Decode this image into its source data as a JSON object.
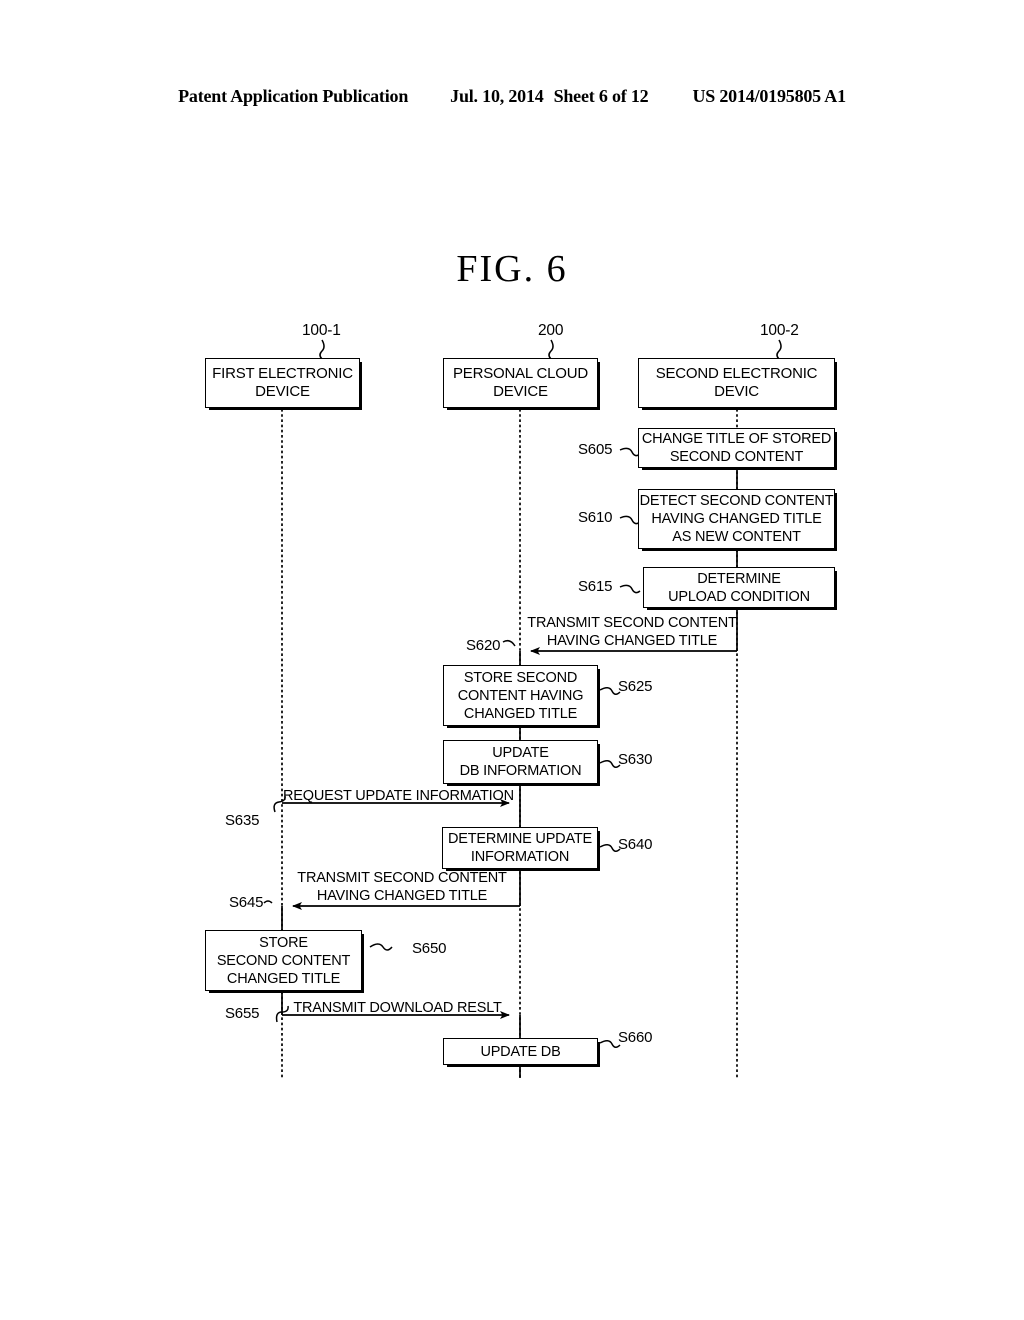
{
  "header": {
    "publication": "Patent Application Publication",
    "date": "Jul. 10, 2014",
    "sheet": "Sheet 6 of 12",
    "patent_number": "US 2014/0195805 A1"
  },
  "figure": {
    "caption": "FIG.  6"
  },
  "actors": [
    {
      "id": "first-electronic-device",
      "ref": "100-1",
      "label": "FIRST ELECTRONIC\nDEVICE"
    },
    {
      "id": "personal-cloud-device",
      "ref": "200",
      "label": "PERSONAL CLOUD\nDEVICE"
    },
    {
      "id": "second-electronic-device",
      "ref": "100-2",
      "label": "SECOND ELECTRONIC\nDEVIC"
    }
  ],
  "steps": [
    {
      "id": "S605",
      "kind": "process",
      "lane": "second-electronic-device",
      "label": "CHANGE TITLE OF STORED\nSECOND CONTENT"
    },
    {
      "id": "S610",
      "kind": "process",
      "lane": "second-electronic-device",
      "label": "DETECT SECOND CONTENT\nHAVING CHANGED TITLE\nAS NEW CONTENT"
    },
    {
      "id": "S615",
      "kind": "process",
      "lane": "second-electronic-device",
      "label": "DETERMINE\nUPLOAD CONDITION"
    },
    {
      "id": "S620",
      "kind": "message",
      "from": "second-electronic-device",
      "to": "personal-cloud-device",
      "label": "TRANSMIT SECOND CONTENT\nHAVING CHANGED TITLE"
    },
    {
      "id": "S625",
      "kind": "process",
      "lane": "personal-cloud-device",
      "label": "STORE SECOND\nCONTENT HAVING\nCHANGED TITLE"
    },
    {
      "id": "S630",
      "kind": "process",
      "lane": "personal-cloud-device",
      "label": "UPDATE\nDB INFORMATION"
    },
    {
      "id": "S635",
      "kind": "message",
      "from": "first-electronic-device",
      "to": "personal-cloud-device",
      "label": "REQUEST UPDATE INFORMATION"
    },
    {
      "id": "S640",
      "kind": "process",
      "lane": "personal-cloud-device",
      "label": "DETERMINE UPDATE\nINFORMATION"
    },
    {
      "id": "S645",
      "kind": "message",
      "from": "personal-cloud-device",
      "to": "first-electronic-device",
      "label": "TRANSMIT SECOND CONTENT\nHAVING CHANGED TITLE"
    },
    {
      "id": "S650",
      "kind": "process",
      "lane": "first-electronic-device",
      "label": "STORE\nSECOND CONTENT\nCHANGED TITLE"
    },
    {
      "id": "S655",
      "kind": "message",
      "from": "first-electronic-device",
      "to": "personal-cloud-device",
      "label": "TRANSMIT DOWNLOAD RESLT"
    },
    {
      "id": "S660",
      "kind": "process",
      "lane": "personal-cloud-device",
      "label": "UPDATE DB"
    }
  ],
  "labels": {
    "actor_1_line1": "FIRST ELECTRONIC",
    "actor_1_line2": "DEVICE",
    "actor_2_line1": "PERSONAL CLOUD",
    "actor_2_line2": "DEVICE",
    "actor_3_line1": "SECOND ELECTRONIC",
    "actor_3_line2": "DEVIC",
    "s605_line1": "CHANGE TITLE OF STORED",
    "s605_line2": "SECOND CONTENT",
    "s610_line1": "DETECT SECOND CONTENT",
    "s610_line2": "HAVING CHANGED TITLE",
    "s610_line3": "AS NEW CONTENT",
    "s615_line1": "DETERMINE",
    "s615_line2": "UPLOAD CONDITION",
    "s620_line1": "TRANSMIT SECOND CONTENT",
    "s620_line2": "HAVING CHANGED TITLE",
    "s625_line1": "STORE SECOND",
    "s625_line2": "CONTENT HAVING",
    "s625_line3": "CHANGED TITLE",
    "s630_line1": "UPDATE",
    "s630_line2": "DB INFORMATION",
    "s635_line1": "REQUEST UPDATE INFORMATION",
    "s640_line1": "DETERMINE UPDATE",
    "s640_line2": "INFORMATION",
    "s645_line1": "TRANSMIT SECOND CONTENT",
    "s645_line2": "HAVING CHANGED TITLE",
    "s650_line1": "STORE",
    "s650_line2": "SECOND CONTENT",
    "s650_line3": "CHANGED TITLE",
    "s655_line1": "TRANSMIT DOWNLOAD RESLT",
    "s660_line1": "UPDATE DB"
  },
  "step_ids": {
    "s605": "S605",
    "s610": "S610",
    "s615": "S615",
    "s620": "S620",
    "s625": "S625",
    "s630": "S630",
    "s635": "S635",
    "s640": "S640",
    "s645": "S645",
    "s650": "S650",
    "s655": "S655",
    "s660": "S660"
  },
  "refs": {
    "first": "100-1",
    "cloud": "200",
    "second": "100-2"
  },
  "colors": {
    "ink": "#000000",
    "paper": "#ffffff"
  }
}
